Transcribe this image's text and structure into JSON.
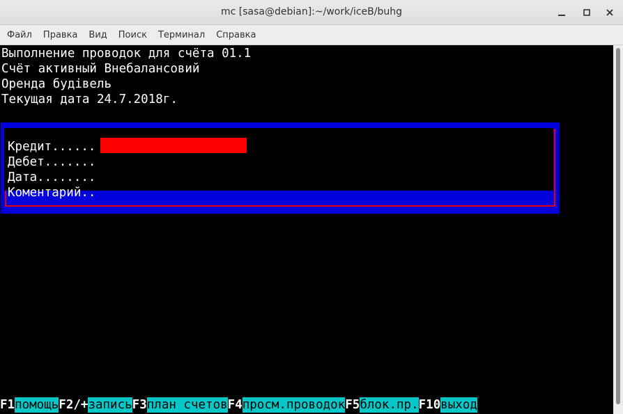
{
  "window": {
    "title": "mc [sasa@debian]:~/work/iceB/buhg"
  },
  "menu": {
    "items": [
      {
        "label": "Файл"
      },
      {
        "label": "Правка"
      },
      {
        "label": "Вид"
      },
      {
        "label": "Поиск"
      },
      {
        "label": "Терминал"
      },
      {
        "label": "Справка"
      }
    ]
  },
  "terminal": {
    "lines": [
      "Выполнение проводок для счёта 01.1",
      "Счёт активный Внебалансовий",
      "Оренда будівель",
      "Текущая дата 24.7.2018г."
    ]
  },
  "dialog": {
    "fields": [
      {
        "label": "Кредит......",
        "value": ""
      },
      {
        "label": "Дебет.......",
        "value": ""
      },
      {
        "label": "Дата........",
        "value": ""
      },
      {
        "label": "Коментарий..",
        "value": ""
      }
    ]
  },
  "function_keys": [
    {
      "key": "F1",
      "label": "помощь"
    },
    {
      "key": "F2/+",
      "label": "запись"
    },
    {
      "key": "F3",
      "label": "план счетов"
    },
    {
      "key": "F4",
      "label": "просм.проводок"
    },
    {
      "key": "F5",
      "label": "блок.пр."
    },
    {
      "key": "F10",
      "label": "выход"
    }
  ],
  "colors": {
    "dialog_background": "#0000dd",
    "dialog_border": "#e00000",
    "active_input": "#ff0000",
    "fkey_label_background": "#00c8c8"
  }
}
